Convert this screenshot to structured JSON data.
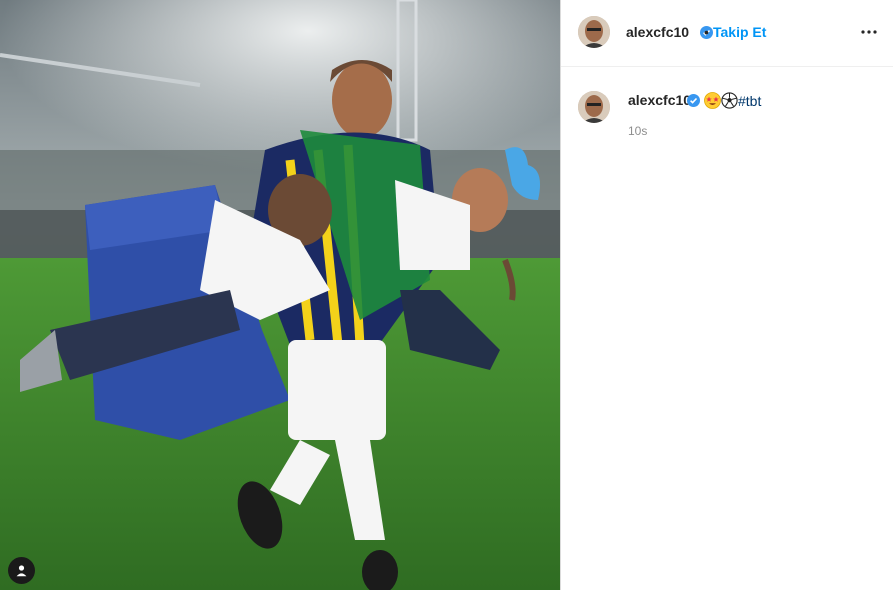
{
  "post": {
    "username": "alexcfc10",
    "separator": "•",
    "follow_label": "Takip Et",
    "more_icon": "more-options-icon",
    "verified_icon": "verified-badge-icon",
    "tag_icon": "user-tag-icon"
  },
  "caption": {
    "username": "alexcfc10",
    "emojis": [
      "star-struck-emoji",
      "soccer-ball-emoji"
    ],
    "hashtag": "#tbt",
    "time": "10s"
  },
  "colors": {
    "link_blue": "#0095f6",
    "verified_blue": "#3897f0",
    "hashtag": "#00376b",
    "text": "#262626",
    "muted": "#8e8e8e"
  }
}
